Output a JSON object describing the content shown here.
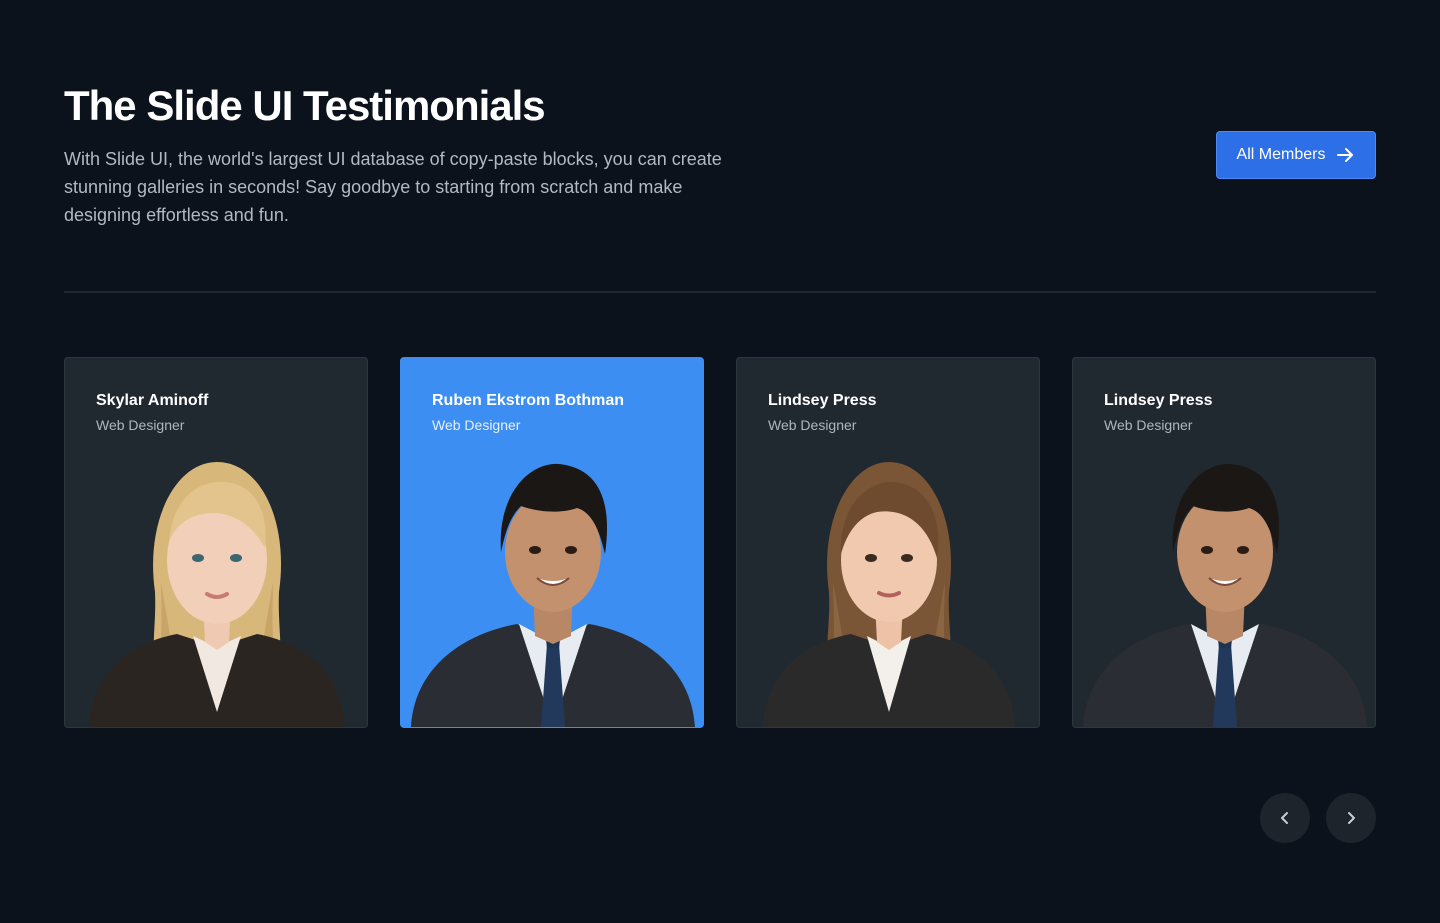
{
  "header": {
    "title": "The Slide UI Testimonials",
    "description": "With Slide UI, the world's largest UI database of copy-paste blocks, you can create stunning galleries in seconds! Say goodbye to starting from scratch and make designing effortless and fun.",
    "all_members_label": "All Members",
    "all_members_icon": "arrow-right-icon"
  },
  "cards": [
    {
      "name": "Skylar Aminoff",
      "role": "Web Designer",
      "active": false,
      "portrait": "woman-blonde-portrait"
    },
    {
      "name": "Ruben Ekstrom Bothman",
      "role": "Web Designer",
      "active": true,
      "portrait": "man-portrait"
    },
    {
      "name": "Lindsey Press",
      "role": "Web Designer",
      "active": false,
      "portrait": "woman-brunette-portrait"
    },
    {
      "name": "Lindsey Press",
      "role": "Web Designer",
      "active": false,
      "portrait": "man-portrait"
    }
  ],
  "carousel": {
    "prev_icon": "chevron-left-icon",
    "next_icon": "chevron-right-icon"
  },
  "colors": {
    "background": "#0c121c",
    "card": "#212930",
    "card_active": "#3d8ef2",
    "button": "#2d6fe6"
  }
}
